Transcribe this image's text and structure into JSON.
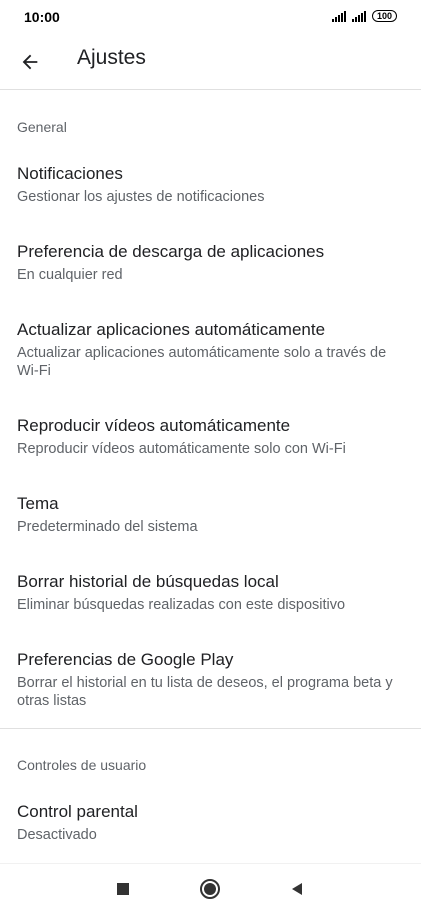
{
  "status_bar": {
    "time": "10:00",
    "battery": "100"
  },
  "app_bar": {
    "title": "Ajustes",
    "back_icon": "arrow-back-icon"
  },
  "sections": {
    "general": {
      "header": "General",
      "items": [
        {
          "title": "Notificaciones",
          "subtitle": "Gestionar los ajustes de notificaciones"
        },
        {
          "title": "Preferencia de descarga de aplicaciones",
          "subtitle": "En cualquier red"
        },
        {
          "title": "Actualizar aplicaciones automáticamente",
          "subtitle": "Actualizar aplicaciones automáticamente solo a través de Wi-Fi"
        },
        {
          "title": "Reproducir vídeos automáticamente",
          "subtitle": "Reproducir vídeos automáticamente solo con Wi-Fi"
        },
        {
          "title": "Tema",
          "subtitle": "Predeterminado del sistema"
        },
        {
          "title": "Borrar historial de búsquedas local",
          "subtitle": "Eliminar búsquedas realizadas con este dispositivo"
        },
        {
          "title": "Preferencias de Google Play",
          "subtitle": "Borrar el historial en tu lista de deseos, el programa beta y otras listas"
        }
      ]
    },
    "user_controls": {
      "header": "Controles de usuario",
      "items": [
        {
          "title": "Control parental",
          "subtitle": "Desactivado"
        }
      ]
    }
  },
  "nav_bar": {
    "icons": [
      "recents-square-icon",
      "home-circle-icon",
      "back-triangle-icon"
    ]
  }
}
